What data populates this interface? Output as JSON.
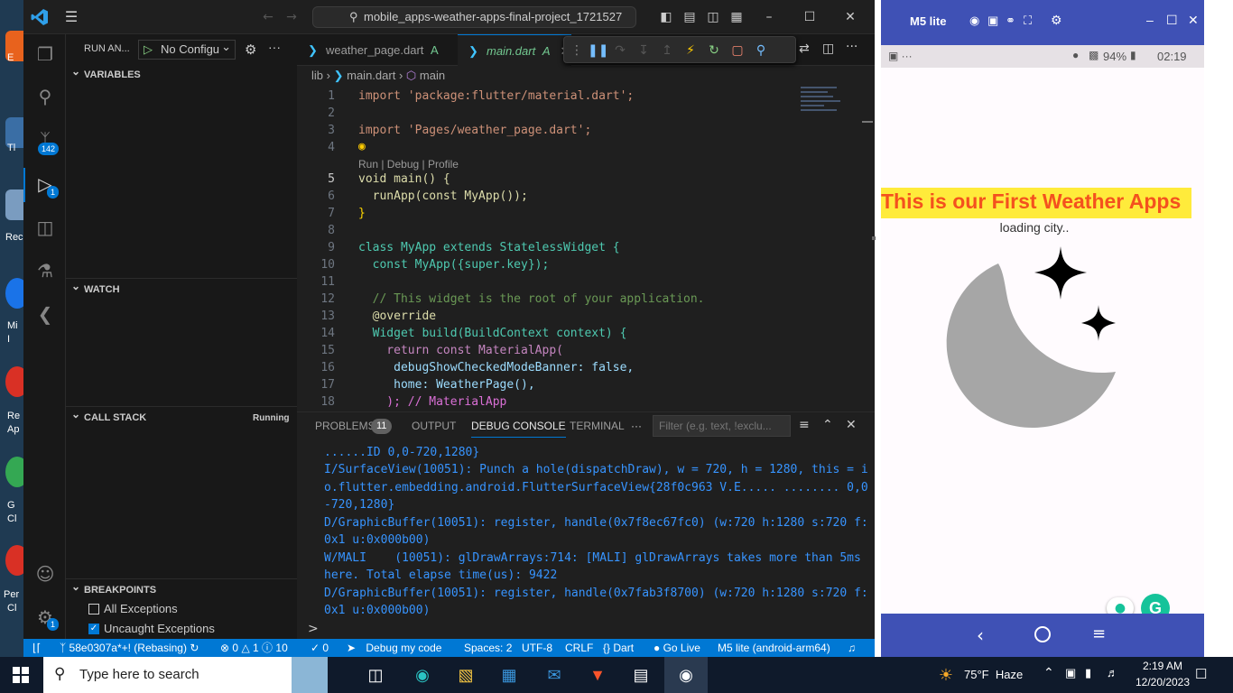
{
  "desktop": {
    "labels": [
      "E",
      "Tl",
      "Rec",
      "Mi",
      "I",
      "Re",
      "Ap",
      "G",
      "Cl",
      "Per",
      "Cl"
    ]
  },
  "vscode": {
    "search_text": "mobile_apps-weather-apps-final-project_1721527",
    "activity": {
      "scm_badge": "142",
      "debug_badge": "1",
      "settings_badge": "1"
    },
    "sidebar": {
      "run_label": "RUN AN...",
      "config_label": "No Configu",
      "variables": "VARIABLES",
      "watch": "WATCH",
      "callstack": "CALL STACK",
      "callstack_status": "Running",
      "breakpoints": "BREAKPOINTS",
      "bp_all": "All Exceptions",
      "bp_uncaught": "Uncaught Exceptions"
    },
    "tabs": [
      {
        "label": "weather_page.dart",
        "flag": "A"
      },
      {
        "label": "main.dart",
        "flag": "A"
      }
    ],
    "breadcrumb": {
      "folder": "lib",
      "file": "main.dart",
      "symbol": "main"
    },
    "codelens": "Run | Debug | Profile",
    "line_numbers": [
      "1",
      "2",
      "3",
      "4",
      "",
      "5",
      "6",
      "7",
      "8",
      "9",
      "10",
      "11",
      "12",
      "13",
      "14",
      "15",
      "16",
      "17",
      "18"
    ],
    "code": {
      "l1": "import 'package:flutter/material.dart';",
      "l3": "import 'Pages/weather_page.dart';",
      "l5": "void main() {",
      "l6": "  runApp(const MyApp());",
      "l7": "}",
      "l9": "class MyApp extends StatelessWidget {",
      "l10": "  const MyApp({super.key});",
      "l12": "  // This widget is the root of your application.",
      "l13": "  @override",
      "l14": "  Widget build(BuildContext context) {",
      "l15": "    return const MaterialApp(",
      "l16": "     debugShowCheckedModeBanner: false,",
      "l17": "     home: WeatherPage(),",
      "l18": "    ); // MaterialApp"
    },
    "panel": {
      "problems": "PROBLEMS",
      "problems_count": "11",
      "output": "OUTPUT",
      "debug_console": "DEBUG CONSOLE",
      "terminal": "TERMINAL",
      "filter_placeholder": "Filter (e.g. text, !exclu...",
      "lines": [
        "......ID 0,0-720,1280}",
        "I/SurfaceView(10051): Punch a hole(dispatchDraw), w = 720, h = 1280, this = i",
        "o.flutter.embedding.android.FlutterSurfaceView{28f0c963 V.E..... ........ 0,0",
        "-720,1280}",
        "D/GraphicBuffer(10051): register, handle(0x7f8ec67fc0) (w:720 h:1280 s:720 f:",
        "0x1 u:0x000b00)",
        "W/MALI    (10051): glDrawArrays:714: [MALI] glDrawArrays takes more than 5ms",
        "here. Total elapse time(us): 9422",
        "D/GraphicBuffer(10051): register, handle(0x7fab3f8700) (w:720 h:1280 s:720 f:",
        "0x1 u:0x000b00)"
      ],
      "prompt": ">"
    },
    "status": {
      "branch": "58e0307a*+! (Rebasing)",
      "errors": "0",
      "warnings": "1",
      "infos": "10",
      "ports": "0",
      "debug": "Debug my code",
      "spaces": "Spaces: 2",
      "encoding": "UTF-8",
      "eol": "CRLF",
      "lang": "Dart",
      "golive": "Go Live",
      "device": "M5 lite (android-arm64)"
    }
  },
  "emulator": {
    "title": "M5 lite",
    "battery": "94%",
    "time": "02:19",
    "app_title": "This is our First Weather Apps",
    "loading": "loading city..",
    "colors": {
      "banner": "#ffeb3b",
      "title_text": "#f4511e",
      "moon": "#a6a6a6",
      "stars": "#000000"
    }
  },
  "taskbar": {
    "search_placeholder": "Type here to search",
    "weather": "75°F  Haze",
    "time": "2:19 AM",
    "date": "12/20/2023"
  }
}
